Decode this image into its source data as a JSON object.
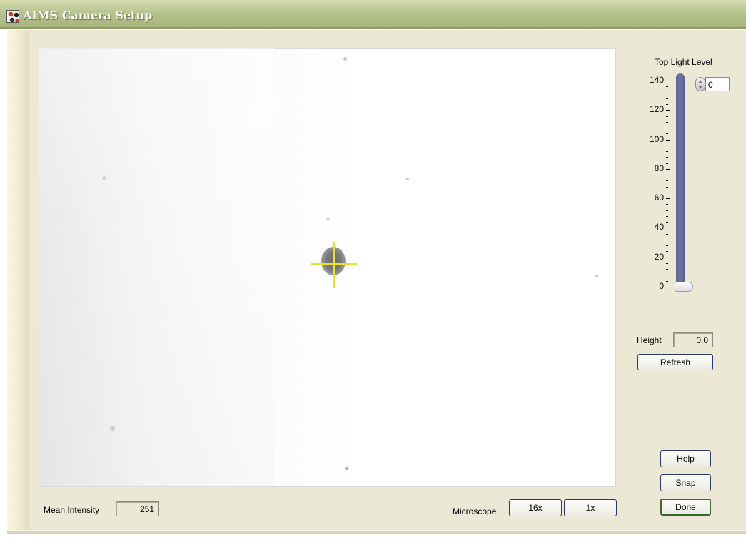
{
  "window": {
    "title": "AIMS Camera Setup"
  },
  "light": {
    "title": "Top Light Level",
    "scale_ticks": [
      "140",
      "120",
      "100",
      "80",
      "60",
      "40",
      "20",
      "0"
    ],
    "scale_min": 0,
    "scale_max": 140,
    "level": 0,
    "value": "0"
  },
  "height": {
    "label": "Height",
    "value": "0.0"
  },
  "buttons": {
    "refresh": "Refresh",
    "help": "Help",
    "snap": "Snap",
    "done": "Done",
    "mag_16x": "16x",
    "mag_1x": "1x"
  },
  "mean_intensity": {
    "label": "Mean Intensity",
    "value": "251"
  },
  "microscope": {
    "label": "Microscope"
  },
  "colors": {
    "slider_track": "#6f74a6",
    "crosshair": "#e8e02a",
    "panel_bg": "#ebe9d5",
    "titlebar": "#b8c490"
  },
  "icons": {
    "app": "aims-app-icon",
    "spinner": "up-down-spinner-icon"
  }
}
